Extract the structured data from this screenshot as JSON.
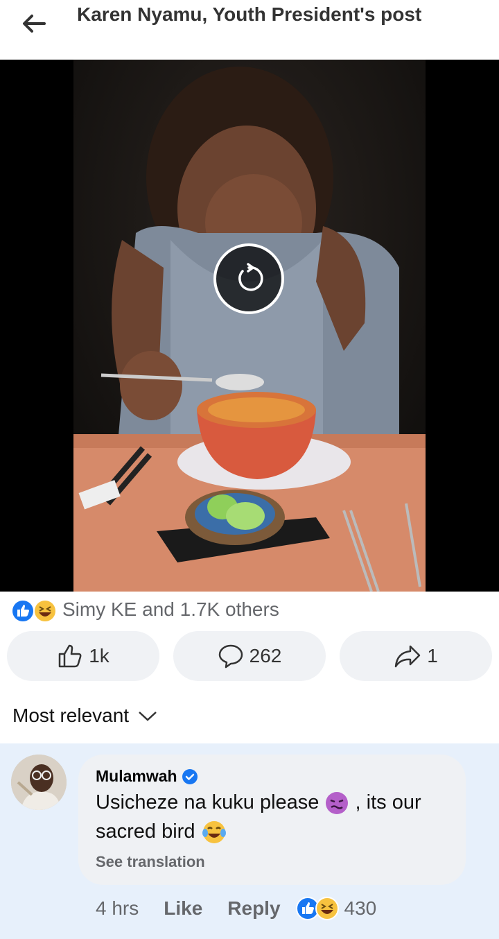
{
  "header": {
    "title": "Karen Nyamu, Youth President's post"
  },
  "video": {
    "replay_icon": "replay-icon"
  },
  "reactions": {
    "icons": [
      "like-icon",
      "laugh-icon"
    ],
    "summary": "Simy KE and 1.7K others"
  },
  "actions": {
    "like_count": "1k",
    "comment_count": "262",
    "share_count": "1"
  },
  "sort": {
    "label": "Most relevant"
  },
  "comment": {
    "author": "Mulamwah",
    "verified": true,
    "text_part1": "Usicheze na kuku please ",
    "text_part2": " , its our sacred bird ",
    "see_translation": "See translation",
    "time": "4 hrs",
    "like_label": "Like",
    "reply_label": "Reply",
    "reaction_count": "430"
  },
  "colors": {
    "accent": "#1877f2",
    "secondary_text": "#65676b",
    "comment_highlight": "#e7f0fb",
    "button_bg": "#f0f2f5"
  }
}
